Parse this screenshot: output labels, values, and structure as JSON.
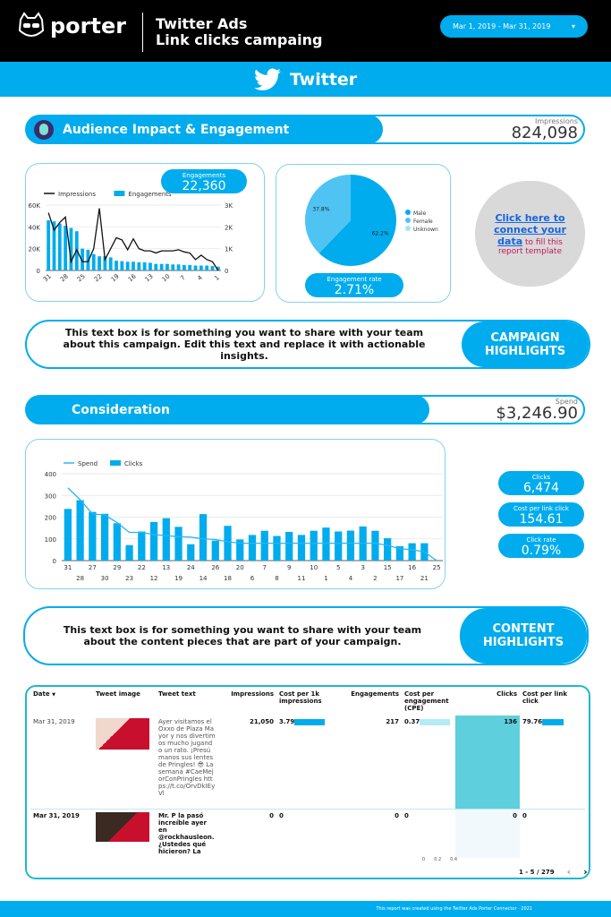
{
  "header": {
    "logo_text": "porter",
    "title_line1": "Twitter Ads",
    "title_line2": "Link clicks campaing",
    "date_range": "Mar 1, 2019 - Mar 31, 2019"
  },
  "band": {
    "title": "Twitter"
  },
  "audience": {
    "title": "Audience Impact & Engagement",
    "kpi_label": "Impressions",
    "kpi_value": "824,098",
    "engagements_label": "Engagements",
    "engagements_value": "22,360",
    "engagement_rate_label": "Engagement rate",
    "engagement_rate_value": "2.71%",
    "connect_link": "Click here to connect your data",
    "connect_rest": " to fill this report template"
  },
  "consideration": {
    "title": "Consideration",
    "kpi_label": "Spend",
    "kpi_value": "$3,246.90",
    "kpis": [
      {
        "label": "Clicks",
        "value": "6,474"
      },
      {
        "label": "Cost per link click",
        "value": "154.61"
      },
      {
        "label": "Click rate",
        "value": "0.79%"
      }
    ]
  },
  "textbox1": {
    "text": "This text box is for something you want to share with your team about this campaign. Edit this text and replace it with actionable insights.",
    "button": "CAMPAIGN HIGHLIGHTS"
  },
  "textbox2": {
    "text": "This text box is for something you want to share with your team about the content pieces that are part of your campaign.",
    "button": "CONTENT HIGHLIGHTS"
  },
  "table": {
    "columns": [
      "Date",
      "Tweet image",
      "Tweet text",
      "Impressions",
      "Cost per 1k impressions",
      "Engagements",
      "Cost per engagement (CPE)",
      "Clicks",
      "Cost per link click"
    ],
    "sort_icon": "sort-down-icon",
    "rows": [
      {
        "date": "Mar 31, 2019",
        "text": "Ayer visitamos el Oxxo de Plaza Mayor y nos divertimos mucho jugando un rato. ¡Presúmanos sus lentes de Pringles! 😎 La semana #CaeMejorConPringles https://t.co/OrvDkIEyVl",
        "impressions": "21,050",
        "cpm": "3.79",
        "engagements": "217",
        "cpe": "0.37",
        "clicks": "136",
        "cplc": "79.76"
      },
      {
        "date": "Mar 31, 2019",
        "text": "Mr. P la pasó increíble ayer en @rockhausleon. ¿Ustedes qué hicieron? La reunión con tus amigos",
        "impressions": "0",
        "cpm": "0",
        "engagements": "0",
        "cpe": "0",
        "clicks": "0",
        "cplc": "0"
      }
    ],
    "cpe_axis": [
      "0",
      "0.2",
      "0.4"
    ],
    "pagination": "1 - 5 / 279"
  },
  "footer": "This report was created using the Twitter Ads Porter Connector · 2021",
  "colors": {
    "accent": "#00aced",
    "dark": "#000000",
    "clicks_highlight": "#5ecfdc"
  },
  "chart_data": [
    {
      "type": "bar",
      "combo": "bar+line",
      "categories": [
        "31",
        "30",
        "29",
        "28",
        "27",
        "26",
        "25",
        "24",
        "23",
        "22",
        "21",
        "20",
        "19",
        "18",
        "17",
        "16",
        "15",
        "14",
        "13",
        "12",
        "11",
        "10",
        "9",
        "8",
        "7",
        "6",
        "5",
        "4",
        "3",
        "2",
        "1"
      ],
      "tick_labels": [
        "31",
        "30",
        "23",
        "28",
        "14",
        "12",
        "2",
        "6",
        "8",
        "15",
        "25"
      ],
      "series": [
        {
          "name": "Impressions",
          "kind": "line",
          "axis": "left",
          "color": "#111111",
          "values": [
            53000,
            37000,
            44000,
            49000,
            8000,
            19000,
            8000,
            8000,
            20000,
            57000,
            10000,
            20000,
            30000,
            28000,
            19000,
            29000,
            20000,
            18000,
            18000,
            16000,
            18000,
            18000,
            18000,
            19000,
            17000,
            16000,
            10000,
            14000,
            10000,
            8000,
            0
          ]
        },
        {
          "name": "Engagements",
          "kind": "bar",
          "axis": "right",
          "color": "#00aced",
          "values": [
            2300,
            2250,
            2150,
            2050,
            1950,
            1800,
            1000,
            950,
            750,
            650,
            650,
            600,
            450,
            425,
            400,
            400,
            375,
            375,
            350,
            300,
            300,
            300,
            275,
            275,
            250,
            250,
            225,
            225,
            225,
            200,
            175
          ]
        }
      ],
      "yleft": {
        "range": [
          0,
          60000
        ],
        "ticks": [
          "0",
          "20K",
          "40K",
          "60K"
        ]
      },
      "yright": {
        "range": [
          0,
          3000
        ],
        "ticks": [
          "0",
          "1K",
          "2K",
          "3K"
        ]
      },
      "legend": "top-left",
      "grid": true
    },
    {
      "type": "pie",
      "slices": [
        {
          "name": "Male",
          "value": 62.2,
          "label": "62.2%",
          "color": "#00aced"
        },
        {
          "name": "Female",
          "value": 37.8,
          "label": "37.8%",
          "color": "#4fc4f2"
        },
        {
          "name": "Unknown",
          "value": 0,
          "color": "#a9e1f8"
        }
      ],
      "legend": "right"
    },
    {
      "type": "bar",
      "combo": "bar+line",
      "categories": [
        "31",
        "28",
        "27",
        "30",
        "29",
        "23",
        "22",
        "12",
        "13",
        "19",
        "24",
        "14",
        "26",
        "18",
        "20",
        "6",
        "7",
        "8",
        "9",
        "11",
        "10",
        "1",
        "5",
        "4",
        "3",
        "2",
        "15",
        "17",
        "16",
        "21",
        "25"
      ],
      "series": [
        {
          "name": "Spend",
          "kind": "line",
          "axis": "left",
          "color": "#29b6f6",
          "values": [
            335,
            280,
            215,
            210,
            175,
            130,
            130,
            120,
            115,
            110,
            108,
            100,
            97,
            87,
            80,
            80,
            80,
            80,
            80,
            80,
            80,
            80,
            80,
            80,
            80,
            80,
            70,
            55,
            50,
            40,
            0
          ]
        },
        {
          "name": "Clicks",
          "kind": "bar",
          "axis": "right",
          "color": "#00aced",
          "values": [
            357,
            417,
            336,
            323,
            258,
            107,
            201,
            267,
            293,
            233,
            113,
            321,
            138,
            240,
            146,
            177,
            206,
            170,
            198,
            177,
            206,
            228,
            201,
            207,
            236,
            206,
            155,
            99,
            120,
            120,
            0
          ]
        }
      ],
      "yleft": {
        "range": [
          0,
          400
        ],
        "ticks": [
          "0",
          "100",
          "200",
          "300",
          "400"
        ]
      },
      "yright": {
        "range": [
          0,
          600
        ],
        "ticks": [
          "0",
          "200",
          "400",
          "600"
        ]
      },
      "legend": "top-left",
      "grid": true
    }
  ]
}
